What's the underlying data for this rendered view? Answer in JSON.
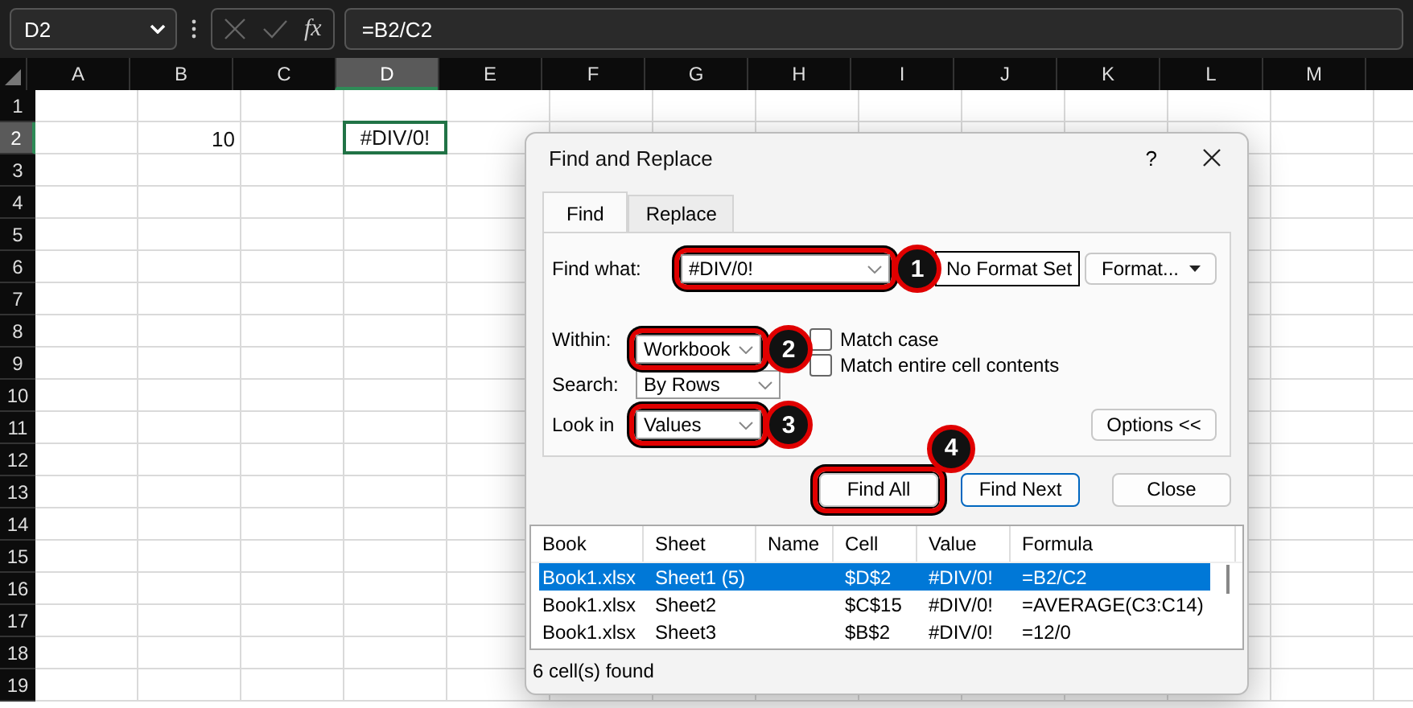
{
  "formula_bar": {
    "name_box": "D2",
    "fx": "fx",
    "formula": "=B2/C2"
  },
  "columns": [
    {
      "label": "A",
      "selected": false
    },
    {
      "label": "B",
      "selected": false
    },
    {
      "label": "C",
      "selected": false
    },
    {
      "label": "D",
      "selected": true
    },
    {
      "label": "E",
      "selected": false
    },
    {
      "label": "F",
      "selected": false
    },
    {
      "label": "G",
      "selected": false
    },
    {
      "label": "H",
      "selected": false
    },
    {
      "label": "I",
      "selected": false
    },
    {
      "label": "J",
      "selected": false
    },
    {
      "label": "K",
      "selected": false
    },
    {
      "label": "L",
      "selected": false
    },
    {
      "label": "M",
      "selected": false
    }
  ],
  "rows": [
    {
      "label": "1",
      "selected": false
    },
    {
      "label": "2",
      "selected": true,
      "cells": [
        null,
        {
          "value": "10",
          "selected": false
        },
        null,
        {
          "value": "#DIV/0!",
          "selected": true
        }
      ]
    },
    {
      "label": "3",
      "selected": false
    },
    {
      "label": "4",
      "selected": false
    },
    {
      "label": "5",
      "selected": false
    },
    {
      "label": "6",
      "selected": false
    },
    {
      "label": "7",
      "selected": false
    },
    {
      "label": "8",
      "selected": false
    },
    {
      "label": "9",
      "selected": false
    },
    {
      "label": "10",
      "selected": false
    },
    {
      "label": "11",
      "selected": false
    },
    {
      "label": "12",
      "selected": false
    },
    {
      "label": "13",
      "selected": false
    },
    {
      "label": "14",
      "selected": false
    },
    {
      "label": "15",
      "selected": false
    },
    {
      "label": "16",
      "selected": false
    },
    {
      "label": "17",
      "selected": false
    },
    {
      "label": "18",
      "selected": false
    },
    {
      "label": "19",
      "selected": false
    }
  ],
  "dialog": {
    "title": "Find and Replace",
    "help": "?",
    "tabs": [
      {
        "label": "Find",
        "selected": true
      },
      {
        "label": "Replace",
        "selected": false
      }
    ],
    "find_what": {
      "label": "Find what:",
      "value": "#DIV/0!",
      "marker": "1"
    },
    "format_preview": "No Format Set",
    "format_button": "Format...",
    "within": {
      "label": "Within:",
      "value": "Workbook",
      "marker": "2"
    },
    "search": {
      "label": "Search:",
      "value": "By Rows"
    },
    "look_in": {
      "label": "Look in",
      "value": "Values",
      "marker": "3"
    },
    "checkboxes": [
      {
        "label": "Match case",
        "checked": false
      },
      {
        "label": "Match entire cell contents",
        "checked": false
      }
    ],
    "options_button": "Options <<",
    "buttons": [
      {
        "label": "Find All",
        "default": false,
        "marker": "4"
      },
      {
        "label": "Find Next",
        "default": true
      },
      {
        "label": "Close",
        "default": false
      }
    ],
    "results": {
      "columns": [
        "Book",
        "Sheet",
        "Name",
        "Cell",
        "Value",
        "Formula"
      ],
      "rows": [
        {
          "selected": true,
          "cells": [
            "Book1.xlsx",
            "Sheet1 (5)",
            null,
            "$D$2",
            "#DIV/0!",
            "=B2/C2"
          ]
        },
        {
          "selected": false,
          "cells": [
            "Book1.xlsx",
            "Sheet2",
            null,
            "$C$15",
            "#DIV/0!",
            "=AVERAGE(C3:C14)"
          ]
        },
        {
          "selected": false,
          "cells": [
            "Book1.xlsx",
            "Sheet3",
            null,
            "$B$2",
            "#DIV/0!",
            "=12/0"
          ]
        }
      ]
    },
    "status": "6 cell(s) found"
  }
}
